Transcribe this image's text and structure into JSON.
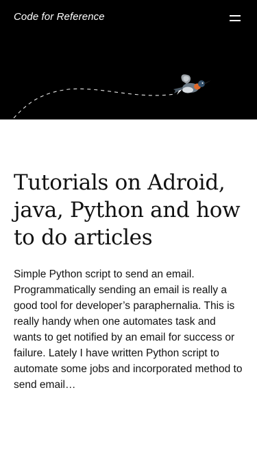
{
  "header": {
    "site_title": "Code for Reference",
    "menu_icon": "hamburger-icon"
  },
  "hero": {
    "illustration": "hummingbird-icon"
  },
  "main": {
    "headline": "Tutorials on Adroid, java, Python and how to do articles",
    "excerpt": "Simple Python script to send an email. Programmatically sending an email is really a good tool for developer’s paraphernalia. This is really handy when one automates task and wants to get notified by an email for success or failure. Lately I have written Python script to automate some jobs and incorporated method to send email…"
  },
  "colors": {
    "hero_background": "#000000",
    "page_background": "#ffffff",
    "text": "#111111"
  }
}
